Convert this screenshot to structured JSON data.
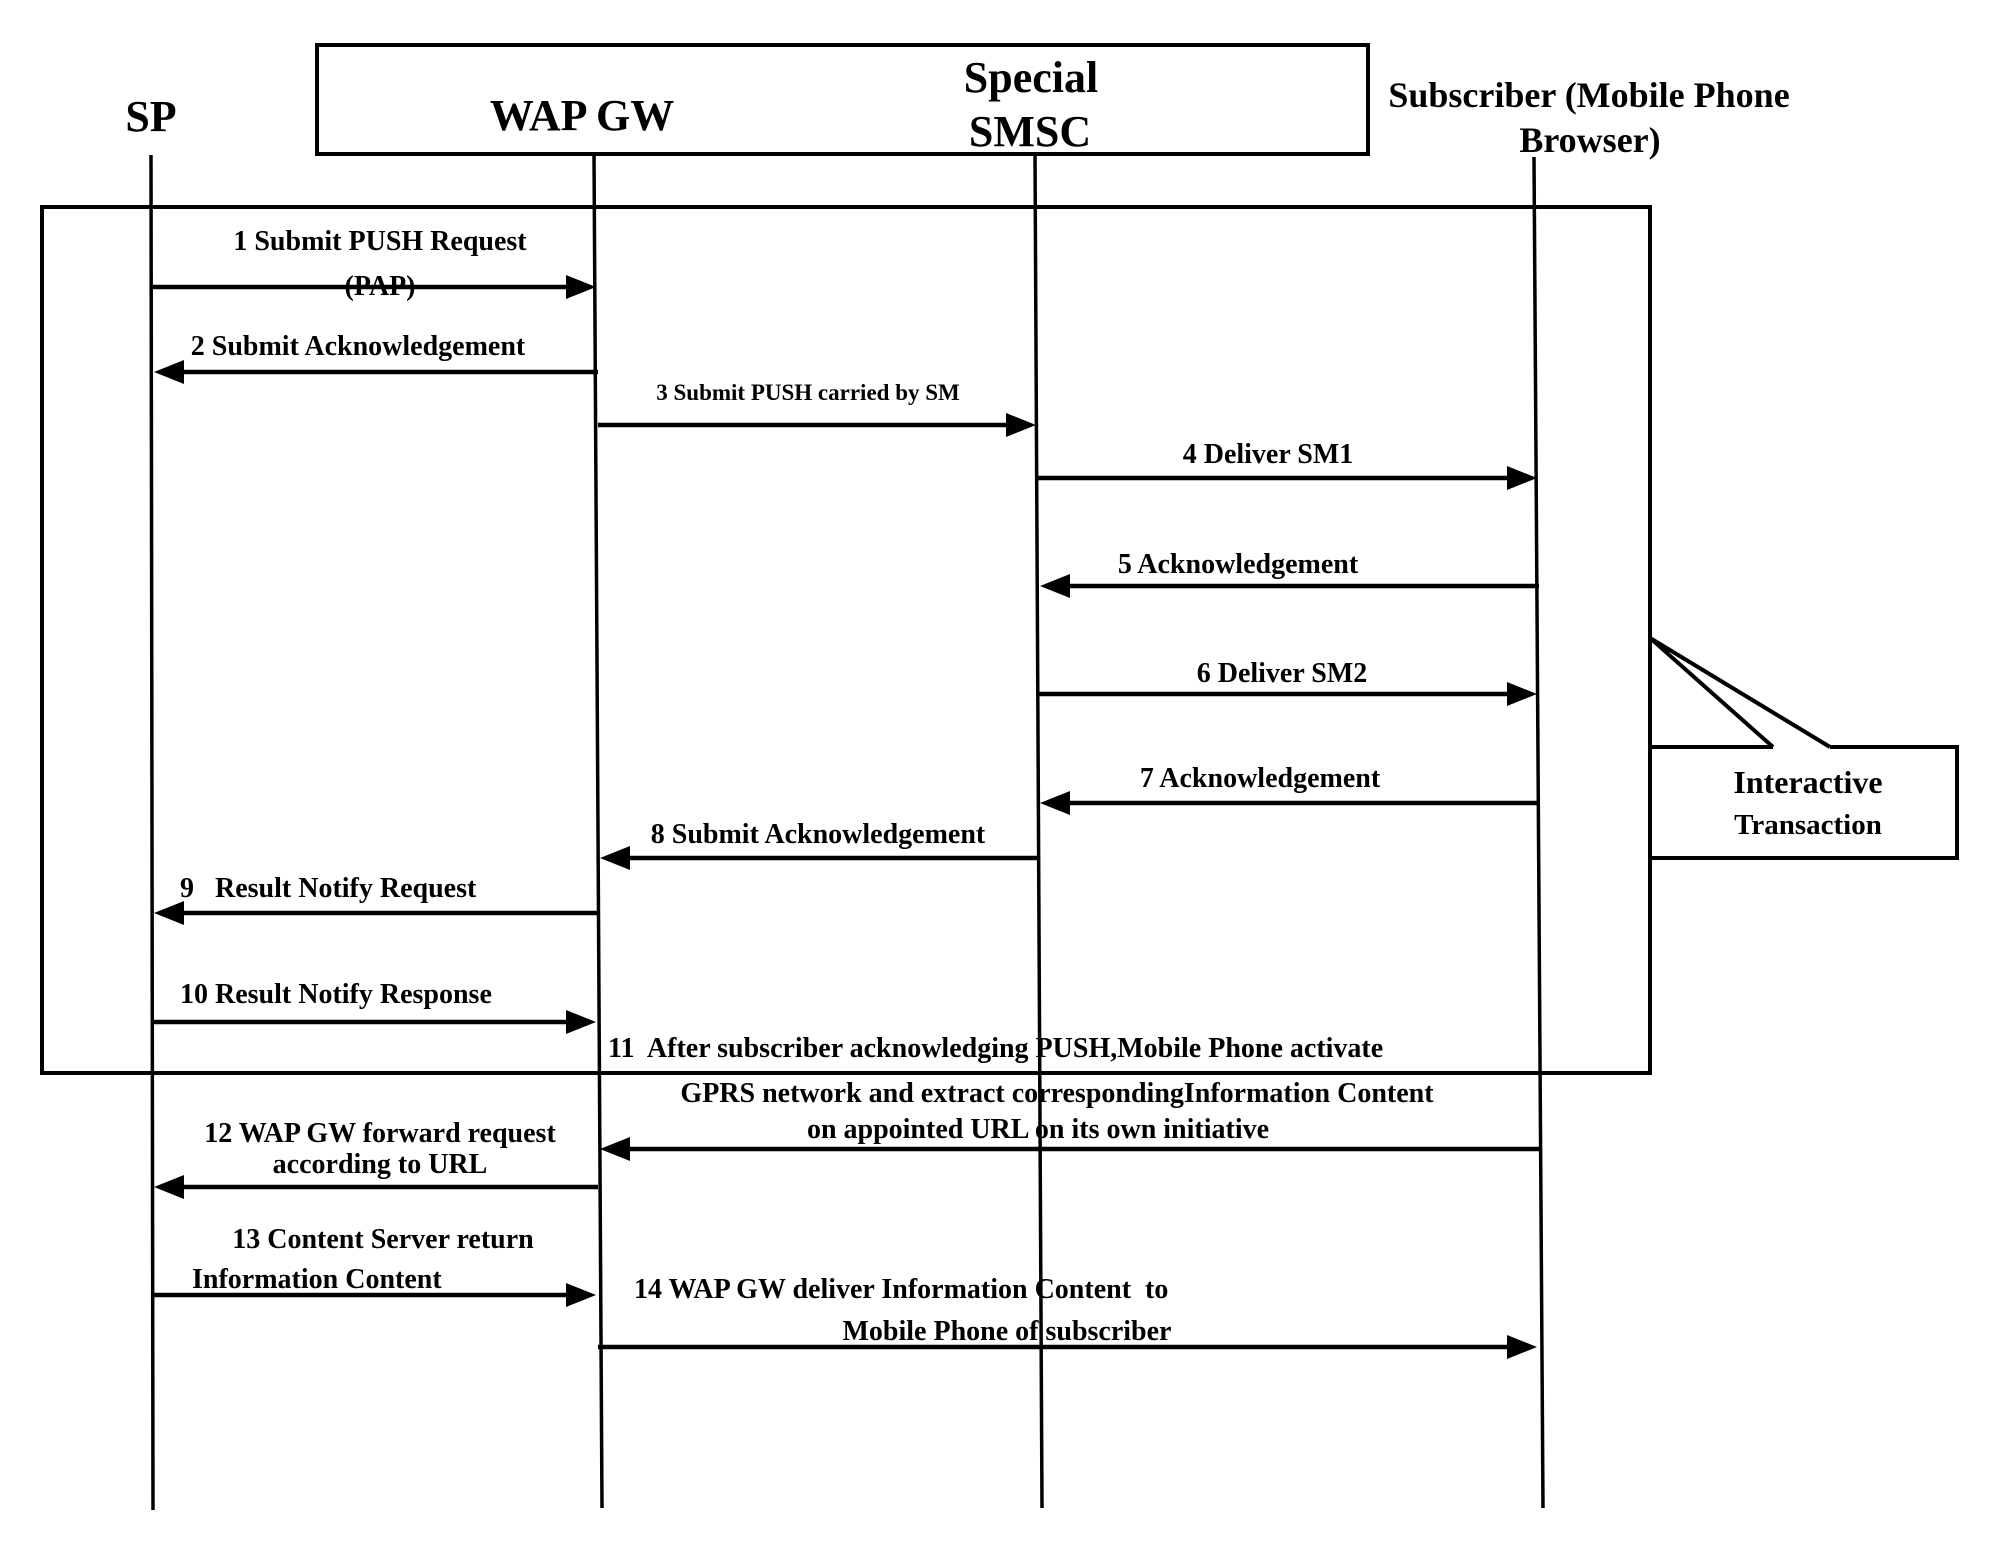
{
  "diagram": {
    "type": "sequence",
    "participants": [
      {
        "id": "sp",
        "label_lines": [
          "SP"
        ]
      },
      {
        "id": "wapgw",
        "label_lines": [
          "WAP GW"
        ]
      },
      {
        "id": "smsc",
        "label_lines": [
          "Special",
          "SMSC"
        ]
      },
      {
        "id": "subscriber",
        "label_lines": [
          "Subscriber (Mobile Phone",
          "Browser)"
        ]
      }
    ],
    "group_box": {
      "participants": [
        "wapgw",
        "smsc"
      ]
    },
    "interactive_transaction": {
      "label_lines": [
        "Interactive",
        "Transaction"
      ],
      "covers_messages": [
        1,
        2,
        3,
        4,
        5,
        6,
        7,
        8,
        9,
        10
      ]
    },
    "messages": [
      {
        "n": 1,
        "from": "sp",
        "to": "wapgw",
        "label_lines": [
          "1 Submit PUSH Request",
          "(PAP)"
        ]
      },
      {
        "n": 2,
        "from": "wapgw",
        "to": "sp",
        "label_lines": [
          "2 Submit Acknowledgement"
        ]
      },
      {
        "n": 3,
        "from": "wapgw",
        "to": "smsc",
        "label_lines": [
          "3 Submit PUSH carried by SM"
        ]
      },
      {
        "n": 4,
        "from": "smsc",
        "to": "subscriber",
        "label_lines": [
          "4 Deliver SM1"
        ]
      },
      {
        "n": 5,
        "from": "subscriber",
        "to": "smsc",
        "label_lines": [
          "5 Acknowledgement"
        ]
      },
      {
        "n": 6,
        "from": "smsc",
        "to": "subscriber",
        "label_lines": [
          "6  Deliver SM2"
        ]
      },
      {
        "n": 7,
        "from": "subscriber",
        "to": "smsc",
        "label_lines": [
          "7 Acknowledgement"
        ]
      },
      {
        "n": 8,
        "from": "smsc",
        "to": "wapgw",
        "label_lines": [
          "8 Submit Acknowledgement"
        ]
      },
      {
        "n": 9,
        "from": "wapgw",
        "to": "sp",
        "label_lines": [
          "9   Result Notify Request"
        ]
      },
      {
        "n": 10,
        "from": "sp",
        "to": "wapgw",
        "label_lines": [
          "10 Result Notify Response"
        ]
      },
      {
        "n": 11,
        "from": "subscriber",
        "to": "wapgw",
        "label_lines": [
          "11  After subscriber acknowledging PUSH,Mobile Phone activate",
          "GPRS network and extract correspondingInformation Content",
          "on appointed URL on its own initiative"
        ]
      },
      {
        "n": 12,
        "from": "wapgw",
        "to": "sp",
        "label_lines": [
          "12 WAP GW forward request",
          "according to URL"
        ]
      },
      {
        "n": 13,
        "from": "sp",
        "to": "wapgw",
        "label_lines": [
          "13 Content Server return",
          "Information Content"
        ]
      },
      {
        "n": 14,
        "from": "wapgw",
        "to": "subscriber",
        "label_lines": [
          "14 WAP GW deliver Information Content  to",
          "Mobile Phone of subscriber"
        ]
      }
    ]
  }
}
